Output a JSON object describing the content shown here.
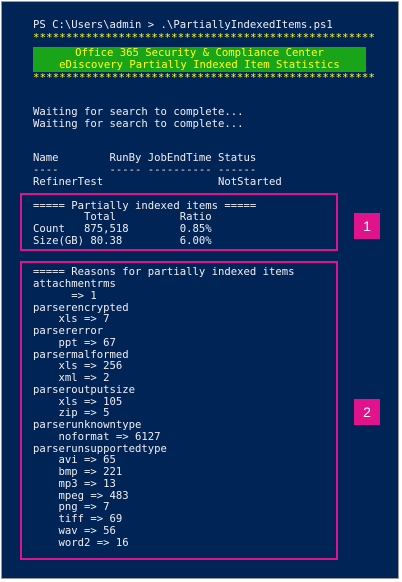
{
  "console": {
    "prompt_line": "PS C:\\Users\\admin > .\\PartiallyIndexedItems.ps1",
    "separator_top": "****************************************************",
    "banner_line1": "Office 365 Security & Compliance Center",
    "banner_line2": "eDiscovery Partially Indexed Item Statistics",
    "separator_bottom": "****************************************************",
    "waiting_line1": "Waiting for search to complete...",
    "waiting_line2": "Waiting for search to complete...",
    "table_header": "Name        RunBy JobEndTime Status",
    "table_rule": "----        ----- ---------- ------",
    "table_row": "RefinerTest                  NotStarted"
  },
  "stats": {
    "title": "===== Partially indexed items =====",
    "header": "        Total          Ratio",
    "count_row": "Count   875,518        0.85%",
    "size_row": "Size(GB) 80.38         6.00%"
  },
  "reasons": {
    "title": "===== Reasons for partially indexed items",
    "lines": [
      "attachmentrms",
      "      => 1",
      "parserencrypted",
      "    xls => 7",
      "parsererror",
      "    ppt => 67",
      "parsermalformed",
      "    xls => 256",
      "    xml => 2",
      "parseroutputsize",
      "    xls => 105",
      "    zip => 5",
      "parserunknowntype",
      "    noformat => 6127",
      "parserunsupportedtype",
      "    avi => 65",
      "    bmp => 221",
      "    mp3 => 13",
      "    mpeg => 483",
      "    png => 7",
      "    tiff => 69",
      "    wav => 56",
      "    word2 => 16"
    ]
  },
  "callouts": {
    "badge1": "1",
    "badge2": "2"
  },
  "colors": {
    "console_background": "#012456",
    "console_text": "#eeedf0",
    "banner_background": "#1aa41a",
    "banner_text": "#ffff1a",
    "separator_text": "#ffff1a",
    "callout_accent": "#e0128c"
  }
}
